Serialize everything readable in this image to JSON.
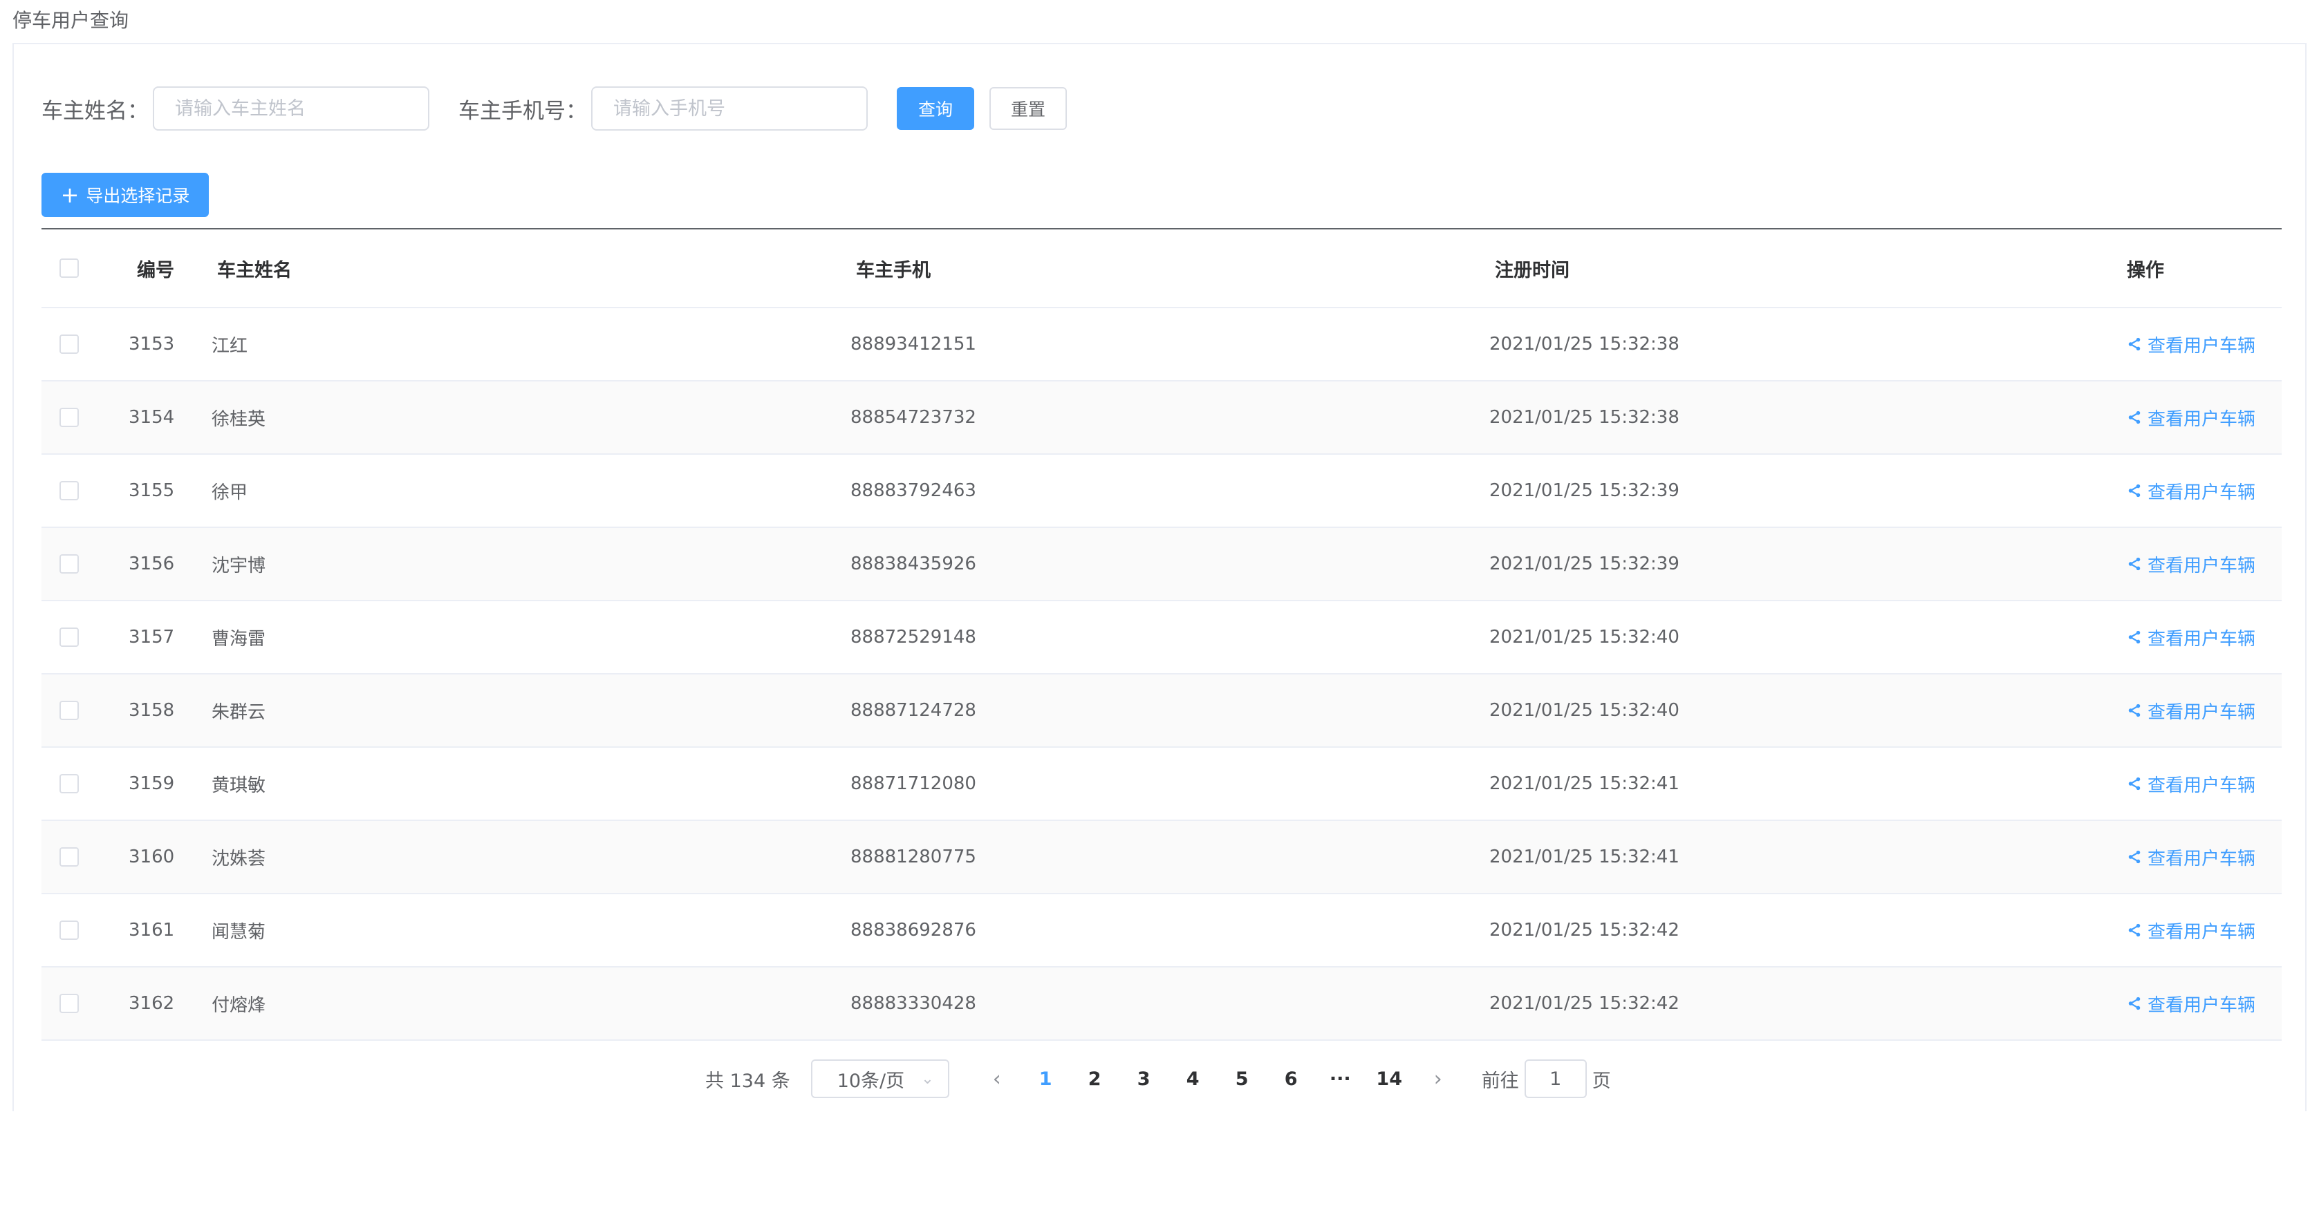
{
  "page": {
    "title": "停车用户查询"
  },
  "search": {
    "name_label": "车主姓名：",
    "name_placeholder": "请输入车主姓名",
    "phone_label": "车主手机号：",
    "phone_placeholder": "请输入手机号",
    "query_label": "查询",
    "reset_label": "重置"
  },
  "toolbar": {
    "export_label": "导出选择记录"
  },
  "table": {
    "headers": {
      "id": "编号",
      "name": "车主姓名",
      "phone": "车主手机",
      "time": "注册时间",
      "op": "操作"
    },
    "op_label": "查看用户车辆",
    "rows": [
      {
        "id": "3153",
        "name": "江红",
        "phone": "88893412151",
        "time": "2021/01/25 15:32:38"
      },
      {
        "id": "3154",
        "name": "徐桂英",
        "phone": "88854723732",
        "time": "2021/01/25 15:32:38"
      },
      {
        "id": "3155",
        "name": "徐甲",
        "phone": "88883792463",
        "time": "2021/01/25 15:32:39"
      },
      {
        "id": "3156",
        "name": "沈宇博",
        "phone": "88838435926",
        "time": "2021/01/25 15:32:39"
      },
      {
        "id": "3157",
        "name": "曹海雷",
        "phone": "88872529148",
        "time": "2021/01/25 15:32:40"
      },
      {
        "id": "3158",
        "name": "朱群云",
        "phone": "88887124728",
        "time": "2021/01/25 15:32:40"
      },
      {
        "id": "3159",
        "name": "黄琪敏",
        "phone": "88871712080",
        "time": "2021/01/25 15:32:41"
      },
      {
        "id": "3160",
        "name": "沈姝荟",
        "phone": "88881280775",
        "time": "2021/01/25 15:32:41"
      },
      {
        "id": "3161",
        "name": "闻慧菊",
        "phone": "88838692876",
        "time": "2021/01/25 15:32:42"
      },
      {
        "id": "3162",
        "name": "付熔烽",
        "phone": "88883330428",
        "time": "2021/01/25 15:32:42"
      }
    ]
  },
  "pagination": {
    "total_text": "共 134 条",
    "page_size": "10条/页",
    "pages": [
      "1",
      "2",
      "3",
      "4",
      "5",
      "6",
      "···",
      "14"
    ],
    "current": "1",
    "goto_prefix": "前往",
    "goto_value": "1",
    "goto_suffix": "页"
  },
  "colors": {
    "primary": "#409eff",
    "border": "#dcdfe6",
    "text": "#606266",
    "header_text": "#303133"
  }
}
